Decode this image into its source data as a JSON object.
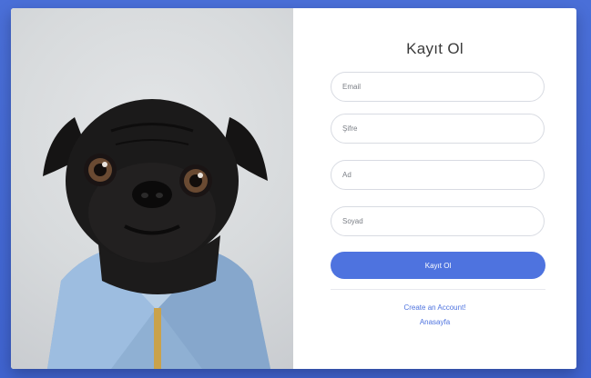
{
  "page": {
    "background_color": "#4a6fd8"
  },
  "register": {
    "title": "Kayıt Ol",
    "fields": {
      "email_placeholder": "Email",
      "password_placeholder": "Şifre",
      "first_name_placeholder": "Ad",
      "last_name_placeholder": "Soyad"
    },
    "submit_label": "Kayıt Ol",
    "links": {
      "create_account": "Create an Account!",
      "home": "Anasayfa"
    }
  },
  "photo": {
    "subject": "pug-in-denim-jacket"
  },
  "colors": {
    "accent": "#4e73df",
    "card": "#ffffff",
    "input_border": "#d8dbe2"
  }
}
